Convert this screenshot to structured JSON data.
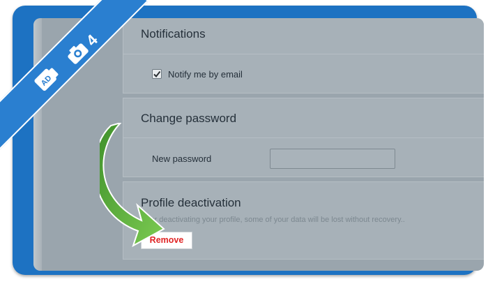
{
  "badge": {
    "step_number": "4"
  },
  "notifications": {
    "title": "Notifications",
    "email_checkbox_label": "Notify me by email",
    "email_checked": true
  },
  "password": {
    "title": "Change password",
    "new_password_label": "New password",
    "new_password_value": ""
  },
  "deactivation": {
    "title": "Profile deactivation",
    "hint": "After deactivating your profile, some of your data will be lost without recovery..",
    "remove_label": "Remove"
  },
  "colors": {
    "frame": "#1d72c2",
    "remove_text": "#e02424",
    "arrow": "#5fae3f"
  }
}
